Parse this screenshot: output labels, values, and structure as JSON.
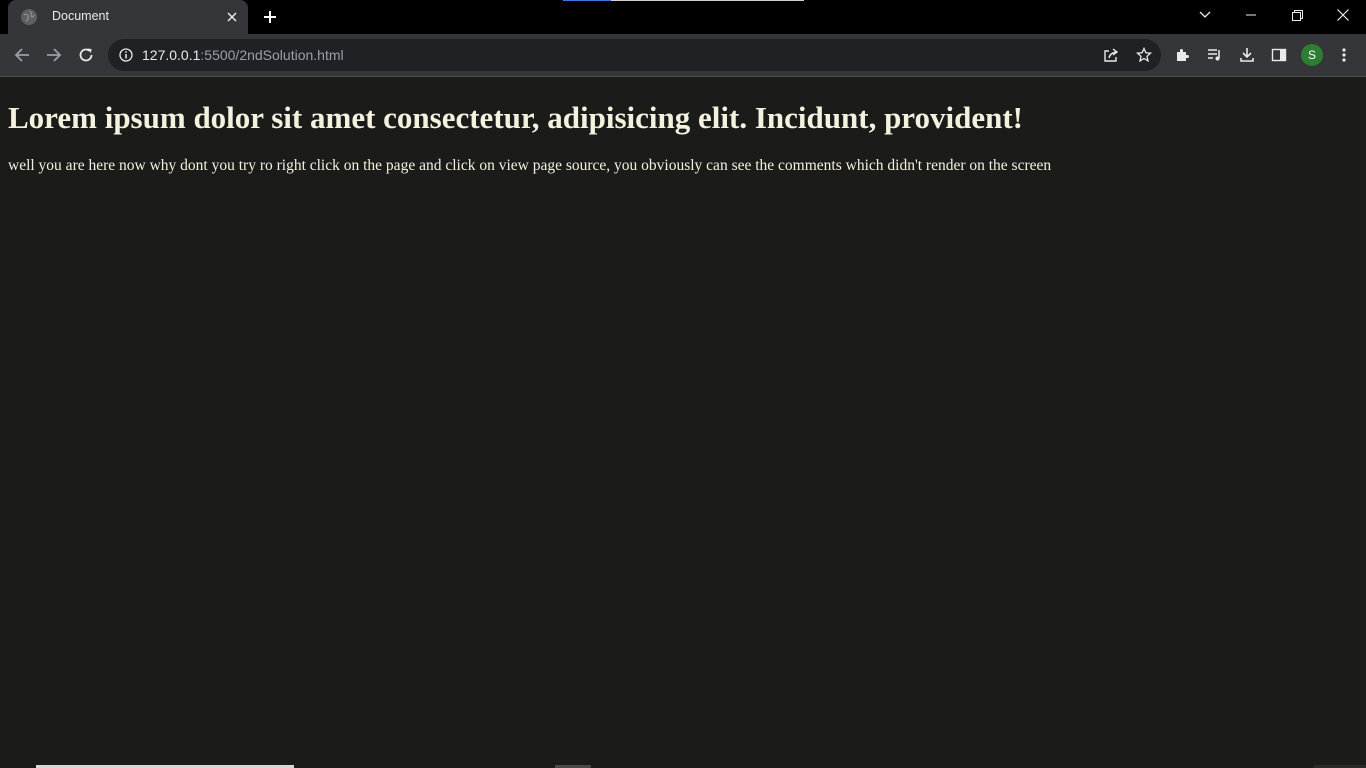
{
  "browser": {
    "tab": {
      "title": "Document",
      "favicon_icon": "globe-icon",
      "close_icon": "close-icon"
    },
    "new_tab_icon": "plus-icon",
    "window_controls": [
      "tab-search-icon",
      "minimize-icon",
      "restore-icon",
      "close-icon"
    ],
    "address_bar": {
      "info_icon": "info-icon",
      "url_host": "127.0.0.1",
      "url_path": ":5500/2ndSolution.html"
    },
    "profile_initial": "S",
    "colors": {
      "titlebar": "#000000",
      "toolbar": "#35363a",
      "omnibox": "#202124",
      "page_background": "#1b1b1a",
      "page_text": "#f4f1df",
      "avatar": "#2e7d32"
    }
  },
  "page": {
    "heading": "Lorem ipsum dolor sit amet consectetur, adipisicing elit. Incidunt, provident!",
    "paragraph": "well you are here now why dont you try ro right click on the page and click on view page source, you obviously can see the comments which didn't render on the screen"
  }
}
